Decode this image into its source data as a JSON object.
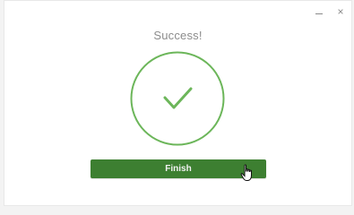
{
  "window": {
    "controls": {
      "minimize_icon": "minimize-icon",
      "close_icon": "close-icon",
      "close_glyph": "×"
    }
  },
  "dialog": {
    "title": "Success!",
    "status_icon": "checkmark-circle-icon",
    "finish_label": "Finish"
  },
  "colors": {
    "accent": "#6cb65a",
    "button": "#3d7f31",
    "title_text": "#8c8c8c"
  }
}
